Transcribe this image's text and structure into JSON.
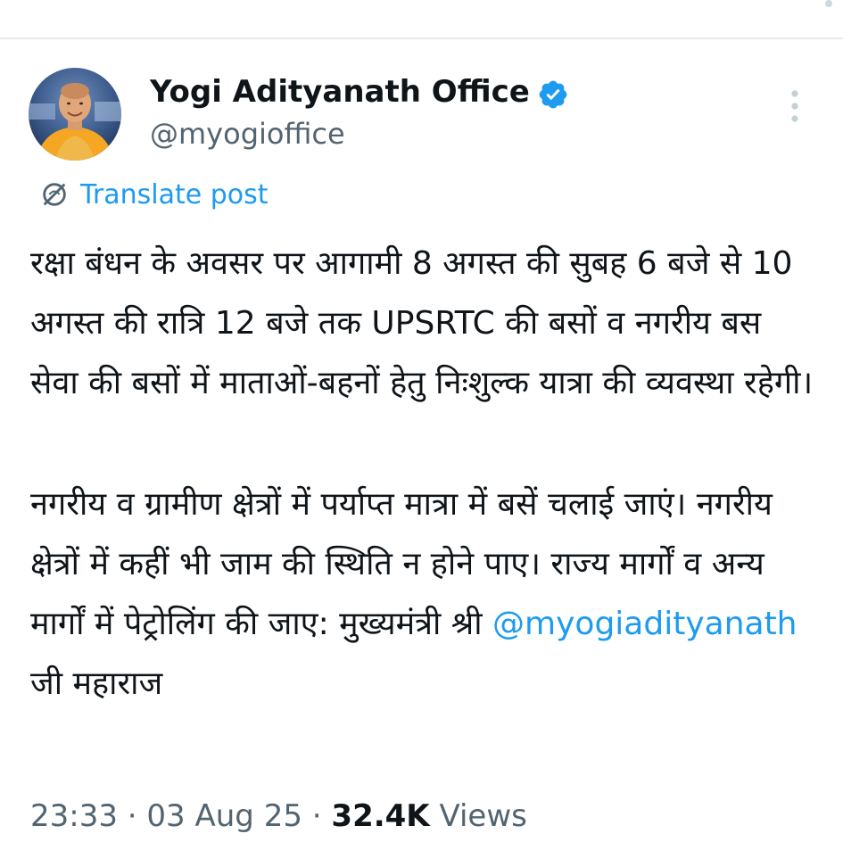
{
  "author": {
    "name": "Yogi Adityanath Office",
    "handle": "@myogioffice",
    "verified": true,
    "verified_color": "#1d9bf0"
  },
  "translate": {
    "label": "Translate post",
    "icon": "globe-slash-icon"
  },
  "tweet": {
    "paragraph1": "रक्षा बंधन के अवसर पर आगामी 8 अगस्त की सुबह 6 बजे से 10 अगस्त की रात्रि 12 बजे तक UPSRTC की बसों व नगरीय बस सेवा की बसों में माताओं-बहनों हेतु निःशुल्क यात्रा की व्यवस्था रहेगी।",
    "paragraph2_before": "नगरीय व ग्रामीण क्षेत्रों में पर्याप्त मात्रा में बसें चलाई जाएं। नगरीय क्षेत्रों में कहीं भी जाम की स्थिति न होने पाए। राज्य मार्गों व अन्य मार्गों में पेट्रोलिंग की जाए: मुख्यमंत्री श्री ",
    "mention": "@myogiadityanath",
    "paragraph2_after": " जी महाराज"
  },
  "meta": {
    "time": "23:33",
    "separator": "·",
    "date": "03 Aug 25",
    "views_count": "32.4K",
    "views_label": "Views"
  },
  "colors": {
    "link": "#1d9bf0",
    "text": "#0f1419",
    "muted": "#536471",
    "avatar_robe": "#f5a623"
  },
  "icons": {
    "more": "more-vertical-icon",
    "verified": "verified-badge-icon"
  }
}
